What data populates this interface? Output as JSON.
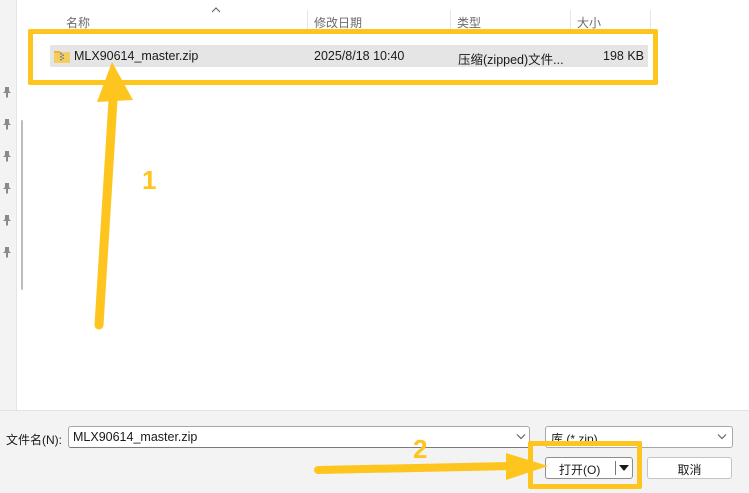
{
  "columns": {
    "name": "名称",
    "modified": "修改日期",
    "type": "类型",
    "size": "大小"
  },
  "files": [
    {
      "name": "MLX90614_master.zip",
      "modified": "2025/8/18 10:40",
      "type": "压缩(zipped)文件...",
      "size": "198 KB",
      "icon": "zip-folder-icon"
    }
  ],
  "nav_pane": {
    "pin_icons": 6,
    "icon": "pin-icon"
  },
  "annotations": {
    "step1": "1",
    "step2": "2",
    "color": "#fdc51d"
  },
  "footer": {
    "filename_label": "文件名(N):",
    "filename_value": "MLX90614_master.zip",
    "filetype_value": "库 (*.zip)",
    "open_label": "打开(O)",
    "cancel_label": "取消"
  }
}
